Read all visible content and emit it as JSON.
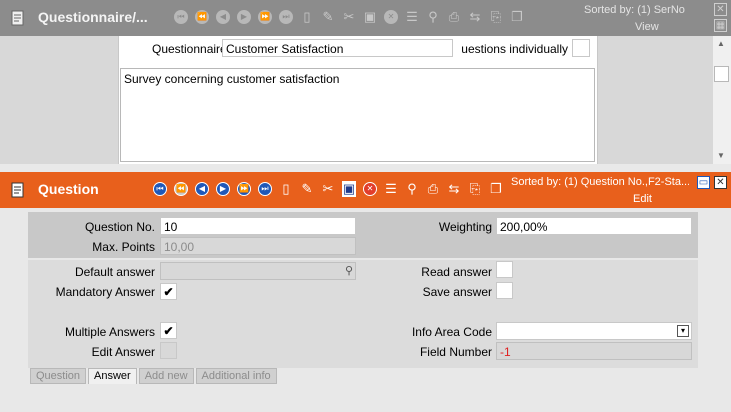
{
  "top_panel": {
    "title": "Questionnaire/...",
    "sorted_by": "Sorted by: (1) SerNo",
    "view_label": "View",
    "questionnaire_label": "Questionnaire",
    "questionnaire_value": "Customer Satisfaction",
    "questions_individually_label": "Questions individually",
    "description": "Survey concerning customer satisfaction"
  },
  "bottom_panel": {
    "title": "Question",
    "sorted_by": "Sorted by: (1) Question No.,F2-Sta...",
    "edit_label": "Edit",
    "question_no_label": "Question No.",
    "question_no_value": "10",
    "max_points_label": "Max. Points",
    "max_points_value": "10,00",
    "weighting_label": "Weighting",
    "weighting_value": "200,00%",
    "default_answer_label": "Default answer",
    "read_answer_label": "Read answer",
    "mandatory_answer_label": "Mandatory Answer",
    "mandatory_checked": "✔",
    "save_answer_label": "Save answer",
    "multiple_answers_label": "Multiple Answers",
    "multiple_checked": "✔",
    "info_area_code_label": "Info Area Code",
    "edit_answer_label": "Edit Answer",
    "field_number_label": "Field Number",
    "field_number_value": "-1"
  },
  "tabs": [
    {
      "label": "Question",
      "active": false
    },
    {
      "label": "Answer",
      "active": true
    },
    {
      "label": "Add new",
      "active": false
    },
    {
      "label": "Additional info",
      "active": false
    }
  ],
  "colors": {
    "top_header": "#8c8c8c",
    "bottom_header": "#e8601c",
    "field_number_red": "#e02020"
  }
}
